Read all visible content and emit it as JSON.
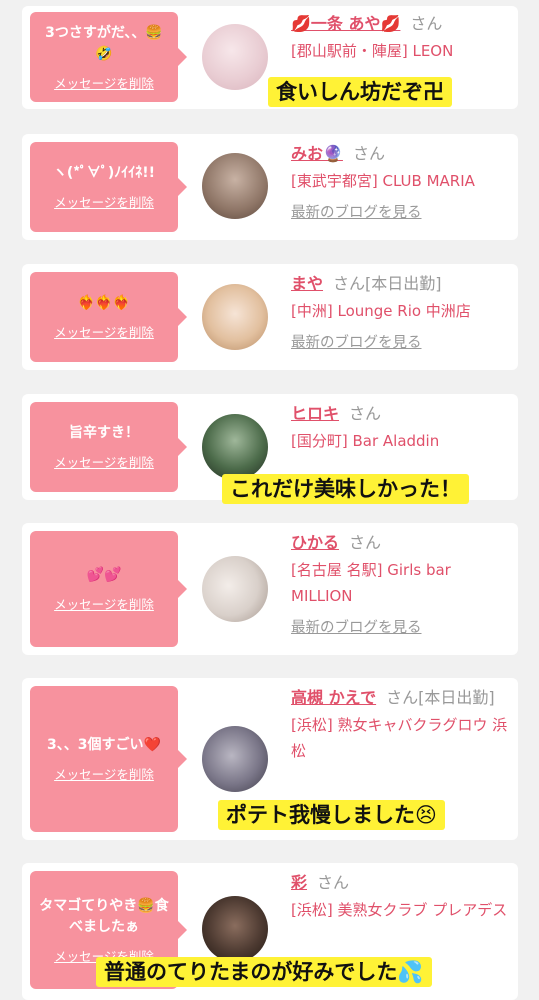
{
  "cards": [
    {
      "message": "3つさすがだ、、🍔🤣",
      "delete_label": "メッセージを削除",
      "name": "💋一条 あや💋",
      "honorific": "さん",
      "work": "",
      "shop": "[郡山駅前・陣屋] LEON",
      "blog_label": ""
    },
    {
      "message": "ヽ(*ﾟ∀ﾟ)ﾉｲｲﾈ!!",
      "delete_label": "メッセージを削除",
      "name": "みお🔮",
      "honorific": "さん",
      "work": "",
      "shop": "[東武宇都宮] CLUB MARIA",
      "blog_label": "最新のブログを見る"
    },
    {
      "message": "❤️‍🔥❤️‍🔥❤️‍🔥",
      "delete_label": "メッセージを削除",
      "name": "まや",
      "honorific": "さん",
      "work": "[本日出勤]",
      "shop": "[中洲] Lounge Rio 中洲店",
      "blog_label": "最新のブログを見る"
    },
    {
      "message": "旨辛すき！",
      "delete_label": "メッセージを削除",
      "name": "ヒロキ",
      "honorific": "さん",
      "work": "",
      "shop": "[国分町] Bar Aladdin",
      "blog_label": ""
    },
    {
      "message": "💕💕",
      "delete_label": "メッセージを削除",
      "name": "ひかる",
      "honorific": "さん",
      "work": "",
      "shop": "[名古屋 名駅] Girls bar MILLION",
      "blog_label": "最新のブログを見る"
    },
    {
      "message": "3、、3個すごい❤️",
      "delete_label": "メッセージを削除",
      "name": "高槻 かえで",
      "honorific": "さん",
      "work": "[本日出勤]",
      "shop": "[浜松] 熟女キャバクラグロウ 浜松",
      "blog_label": ""
    },
    {
      "message": "タマゴてりやき🍔食べましたぁ",
      "delete_label": "メッセージを削除",
      "name": "彩",
      "honorific": "さん",
      "work": "",
      "shop": "[浜松] 美熟女クラブ プレアデス",
      "blog_label": ""
    }
  ],
  "captions": [
    "食いしん坊だぞ卍",
    "これだけ美味しかった！",
    "ポテト我慢しました😣",
    "普通のてりたまのが好みでした💦"
  ],
  "colors": {
    "accent": "#e0506a",
    "bubble": "#f7929e",
    "caption_bg": "#fff236",
    "page_bg": "#f1f1f1"
  }
}
